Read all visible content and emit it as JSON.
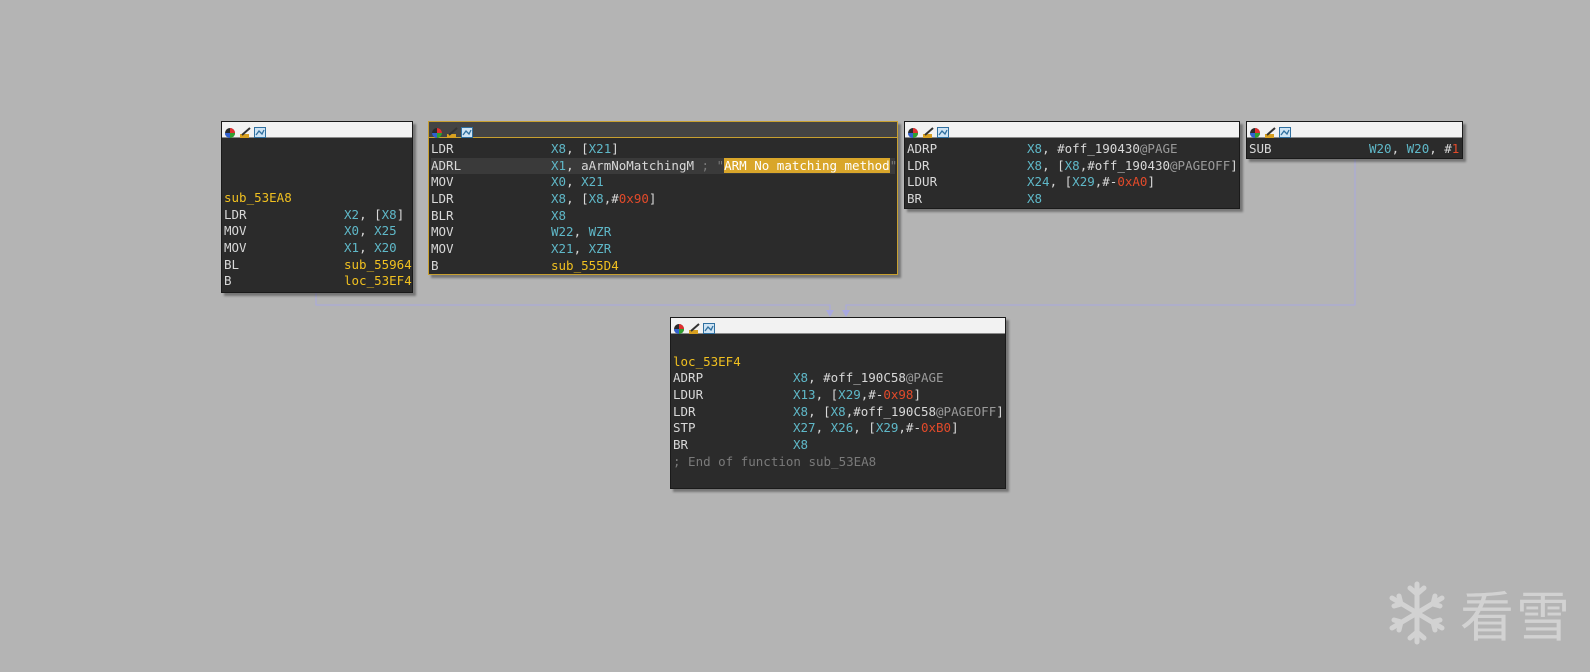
{
  "nodes": {
    "n1": {
      "lines": [
        {
          "label": "sub_53EA8"
        },
        {
          "mn": "LDR",
          "ops": [
            {
              "t": "X2",
              "c": "reg"
            },
            {
              "t": ", ",
              "c": "txt"
            },
            {
              "t": "[",
              "c": "txt"
            },
            {
              "t": "X8",
              "c": "reg"
            },
            {
              "t": "]",
              "c": "txt"
            }
          ]
        },
        {
          "mn": "MOV",
          "ops": [
            {
              "t": "X0",
              "c": "reg"
            },
            {
              "t": ", ",
              "c": "txt"
            },
            {
              "t": "X25",
              "c": "reg"
            }
          ]
        },
        {
          "mn": "MOV",
          "ops": [
            {
              "t": "X1",
              "c": "reg"
            },
            {
              "t": ", ",
              "c": "txt"
            },
            {
              "t": "X20",
              "c": "reg"
            }
          ]
        },
        {
          "mn": "BL",
          "ops": [
            {
              "t": "sub_55964",
              "c": "lbl"
            }
          ]
        },
        {
          "mn": "B",
          "ops": [
            {
              "t": "loc_53EF4",
              "c": "lbl"
            }
          ]
        }
      ]
    },
    "n2": {
      "lines": [
        {
          "mn": "LDR",
          "ops": [
            {
              "t": "X8",
              "c": "reg"
            },
            {
              "t": ", ",
              "c": "txt"
            },
            {
              "t": "[",
              "c": "txt"
            },
            {
              "t": "X21",
              "c": "reg"
            },
            {
              "t": "]",
              "c": "txt"
            }
          ]
        },
        {
          "mn": "ADRL",
          "hl": true,
          "ops": [
            {
              "t": "X1",
              "c": "reg"
            },
            {
              "t": ", aArmNoMatchingM ",
              "c": "txt"
            },
            {
              "t": "; \"",
              "c": "cmt"
            },
            {
              "t": "ARM No matching method",
              "c": "strhl"
            },
            {
              "t": "\"",
              "c": "cmt"
            }
          ]
        },
        {
          "mn": "MOV",
          "ops": [
            {
              "t": "X0",
              "c": "reg"
            },
            {
              "t": ", ",
              "c": "txt"
            },
            {
              "t": "X21",
              "c": "reg"
            }
          ]
        },
        {
          "mn": "LDR",
          "ops": [
            {
              "t": "X8",
              "c": "reg"
            },
            {
              "t": ", ",
              "c": "txt"
            },
            {
              "t": "[",
              "c": "txt"
            },
            {
              "t": "X8",
              "c": "reg"
            },
            {
              "t": ",#",
              "c": "txt"
            },
            {
              "t": "0x90",
              "c": "num"
            },
            {
              "t": "]",
              "c": "txt"
            }
          ]
        },
        {
          "mn": "BLR",
          "ops": [
            {
              "t": "X8",
              "c": "reg"
            }
          ]
        },
        {
          "mn": "MOV",
          "ops": [
            {
              "t": "W22",
              "c": "reg"
            },
            {
              "t": ", ",
              "c": "txt"
            },
            {
              "t": "WZR",
              "c": "reg"
            }
          ]
        },
        {
          "mn": "MOV",
          "ops": [
            {
              "t": "X21",
              "c": "reg"
            },
            {
              "t": ", ",
              "c": "txt"
            },
            {
              "t": "XZR",
              "c": "reg"
            }
          ]
        },
        {
          "mn": "B",
          "ops": [
            {
              "t": "sub_555D4",
              "c": "lbl"
            }
          ]
        }
      ]
    },
    "n3": {
      "lines": [
        {
          "mn": "ADRP",
          "ops": [
            {
              "t": "X8",
              "c": "reg"
            },
            {
              "t": ", #off_190430",
              "c": "txt"
            },
            {
              "t": "@PAGE",
              "c": "dim"
            }
          ]
        },
        {
          "mn": "LDR",
          "ops": [
            {
              "t": "X8",
              "c": "reg"
            },
            {
              "t": ", ",
              "c": "txt"
            },
            {
              "t": "[",
              "c": "txt"
            },
            {
              "t": "X8",
              "c": "reg"
            },
            {
              "t": ",#off_190430",
              "c": "txt"
            },
            {
              "t": "@PAGEOFF",
              "c": "dim"
            },
            {
              "t": "]",
              "c": "txt"
            }
          ]
        },
        {
          "mn": "LDUR",
          "ops": [
            {
              "t": "X24",
              "c": "reg"
            },
            {
              "t": ", ",
              "c": "txt"
            },
            {
              "t": "[",
              "c": "txt"
            },
            {
              "t": "X29",
              "c": "reg"
            },
            {
              "t": ",#-",
              "c": "txt"
            },
            {
              "t": "0xA0",
              "c": "num"
            },
            {
              "t": "]",
              "c": "txt"
            }
          ]
        },
        {
          "mn": "BR",
          "ops": [
            {
              "t": "X8",
              "c": "reg"
            }
          ]
        }
      ]
    },
    "n4": {
      "lines": [
        {
          "mn": "SUB",
          "ops": [
            {
              "t": "W20",
              "c": "reg"
            },
            {
              "t": ", ",
              "c": "txt"
            },
            {
              "t": "W20",
              "c": "reg"
            },
            {
              "t": ", #",
              "c": "txt"
            },
            {
              "t": "1",
              "c": "num"
            }
          ]
        }
      ]
    },
    "n5": {
      "lines": [
        {
          "blank": true
        },
        {
          "label": "loc_53EF4"
        },
        {
          "mn": "ADRP",
          "ops": [
            {
              "t": "X8",
              "c": "reg"
            },
            {
              "t": ", #off_190C58",
              "c": "txt"
            },
            {
              "t": "@PAGE",
              "c": "dim"
            }
          ]
        },
        {
          "mn": "LDUR",
          "ops": [
            {
              "t": "X13",
              "c": "reg"
            },
            {
              "t": ", ",
              "c": "txt"
            },
            {
              "t": "[",
              "c": "txt"
            },
            {
              "t": "X29",
              "c": "reg"
            },
            {
              "t": ",#-",
              "c": "txt"
            },
            {
              "t": "0x98",
              "c": "num"
            },
            {
              "t": "]",
              "c": "txt"
            }
          ]
        },
        {
          "mn": "LDR",
          "ops": [
            {
              "t": "X8",
              "c": "reg"
            },
            {
              "t": ", ",
              "c": "txt"
            },
            {
              "t": "[",
              "c": "txt"
            },
            {
              "t": "X8",
              "c": "reg"
            },
            {
              "t": ",#off_190C58",
              "c": "txt"
            },
            {
              "t": "@PAGEOFF",
              "c": "dim"
            },
            {
              "t": "]",
              "c": "txt"
            }
          ]
        },
        {
          "mn": "STP",
          "ops": [
            {
              "t": "X27",
              "c": "reg"
            },
            {
              "t": ", ",
              "c": "txt"
            },
            {
              "t": "X26",
              "c": "reg"
            },
            {
              "t": ", ",
              "c": "txt"
            },
            {
              "t": "[",
              "c": "txt"
            },
            {
              "t": "X29",
              "c": "reg"
            },
            {
              "t": ",#-",
              "c": "txt"
            },
            {
              "t": "0xB0",
              "c": "num"
            },
            {
              "t": "]",
              "c": "txt"
            }
          ]
        },
        {
          "mn": "BR",
          "ops": [
            {
              "t": "X8",
              "c": "reg"
            }
          ]
        },
        {
          "comment": "; End of function sub_53EA8"
        }
      ]
    }
  },
  "watermark": {
    "text": "看雪",
    "icon": "snowflake-icon"
  },
  "titlebar_icons": [
    "node-color-icon",
    "edit-node-icon",
    "graph-view-icon"
  ],
  "colors": {
    "background": "#b4b4b4",
    "node_bg": "#2b2b2b",
    "label": "#f0c020",
    "register": "#5fb8c8",
    "number": "#e24a2a",
    "string_highlight": "#d9a62a",
    "edge": "#a8a8e0"
  }
}
